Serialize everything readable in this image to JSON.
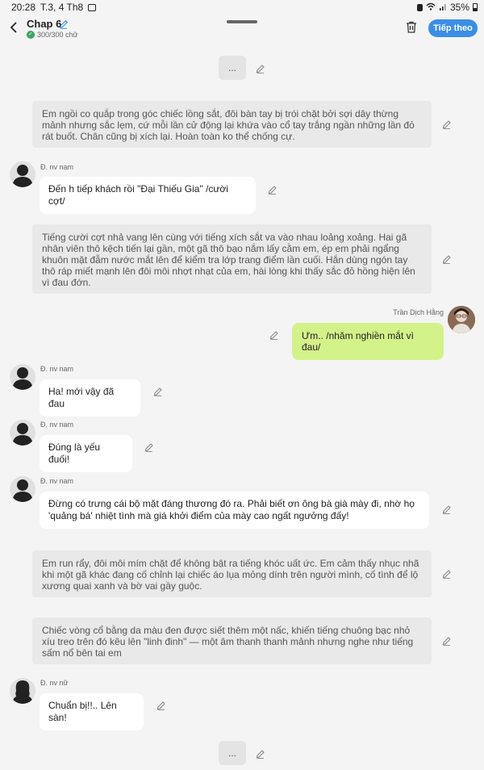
{
  "status_bar": {
    "time": "20:28",
    "date": "T.3, 4 Th8",
    "battery": "35%"
  },
  "header": {
    "title": "Chap 6",
    "counter": "300/300 chữ",
    "next_label": "Tiếp theo"
  },
  "ellipsis": "...",
  "messages": {
    "n1": "Em ngồi co quắp trong góc chiếc lồng sắt, đôi bàn tay bị trói chặt bởi sợi dây thừng mảnh nhưng sắc lẹm, cứ mỗi lần cử động lại khứa vào cổ tay trắng ngần những lần đỏ rát buốt. Chân cũng bị xích lại. Hoàn toàn ko thể chống cự.",
    "s1": "Đ. nv nam",
    "b1": "Đến h tiếp khách rồi \"Đại Thiếu Gia\" /cười cợt/",
    "n2": "Tiếng cười cợt nhả vang lên cùng với tiếng xích sắt va vào nhau loảng xoảng. Hai gã nhân viên thô kệch tiến lại gần, một gã thô bạo nắm lấy cằm em, ép em phải ngẩng khuôn mặt đẫm nước mắt lên để kiểm tra lớp trang điểm lần cuối. Hắn dùng ngón tay thô ráp miết mạnh lên đôi môi nhợt nhạt của em, hài lòng khi thấy sắc đỏ hồng hiện lên vì đau đớn.",
    "me_name": "Trần Dịch Hằng",
    "me1": "Ưm.. /nhăm nghiền mắt vì đau/",
    "s2": "Đ. nv nam",
    "b2": "Ha! mới vậy đã đau",
    "s3": "Đ. nv nam",
    "b3": "Đúng là yếu đuối!",
    "s4": "Đ. nv nam",
    "b4": "Đừng có trưng cái bộ mặt đáng thương đó ra. Phải biết ơn ông bà già mày đi, nhờ họ 'quảng bá' nhiệt tình mà giá khởi điểm của mày cao ngất ngưởng đấy!",
    "n3": "Em run rẩy, đôi môi mím chặt để không bật ra tiếng khóc uất ức. Em cảm thấy nhục nhã khi một gã khác đang cố chỉnh lại chiếc áo lụa mỏng dính trên người mình, cố tình để lộ xương quai xanh và bờ vai gầy guộc.",
    "n4": "Chiếc vòng cổ bằng da màu đen được siết thêm một nấc, khiến tiếng chuông bạc nhỏ xíu treo trên đó kêu lên \"linh đinh\" — một âm thanh thanh mảnh nhưng nghe như tiếng sấm nổ bên tai em",
    "s5": "Đ. nv nữ",
    "b5": "Chuẩn bị!!.. Lên sàn!"
  },
  "colors": {
    "accent": "#3b8ee5",
    "me_bubble": "#d3f28a",
    "narration_bg": "#e9e9e9"
  }
}
